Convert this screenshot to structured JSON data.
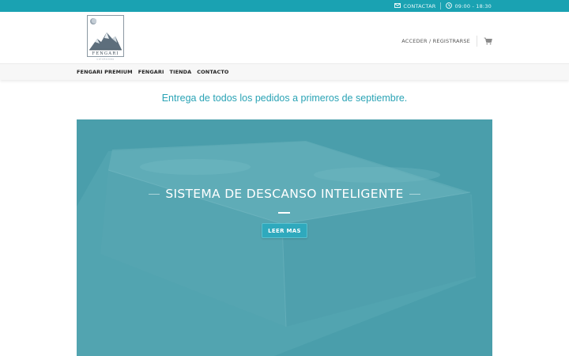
{
  "topbar": {
    "contact_label": "CONTACTAR",
    "contact_icon": "envelope-icon",
    "hours_label": "09:00 - 18:30",
    "hours_icon": "clock-icon"
  },
  "header": {
    "logo_text": "FENGARI",
    "logo_subtext": "colchones",
    "account_label": "ACCEDER / REGISTRARSE",
    "cart_icon": "cart-icon"
  },
  "nav": {
    "items": [
      {
        "label": "FENGARI PREMIUM"
      },
      {
        "label": "FENGARI"
      },
      {
        "label": "TIENDA"
      },
      {
        "label": "CONTACTO"
      }
    ]
  },
  "notice": {
    "text": "Entrega de todos los pedidos a primeros de septiembre."
  },
  "hero": {
    "title": "SISTEMA DE DESCANSO INTELIGENTE",
    "button_label": "LEER MAS"
  },
  "colors": {
    "accent": "#1aa2b2",
    "notice_text": "#2aa3b5",
    "hero_overlay": "#4a9eab",
    "button": "#2fa9bd"
  }
}
